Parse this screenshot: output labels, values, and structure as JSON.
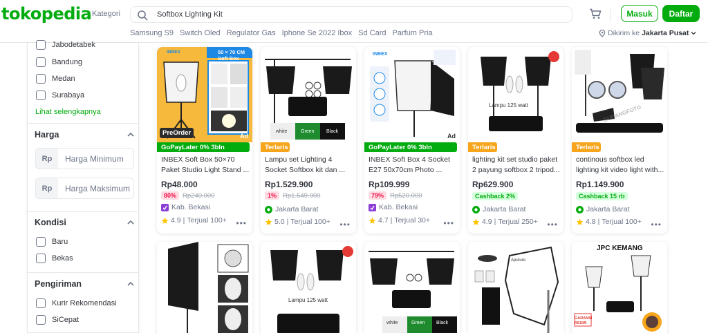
{
  "header": {
    "logo": "tokopedia",
    "kategori": "Kategori",
    "search_value": "Softbox Lighting Kit",
    "login_label": "Masuk",
    "register_label": "Daftar",
    "keywords": [
      "Samsung S9",
      "Switch Oled",
      "Regulator Gas",
      "Iphone Se 2022 Ibox",
      "Sd Card",
      "Parfum Pria"
    ],
    "location_prefix": "Dikirim ke",
    "location_value": "Jakarta Pusat"
  },
  "sidebar": {
    "locations": [
      "Jabodetabek",
      "Bandung",
      "Medan",
      "Surabaya"
    ],
    "see_more": "Lihat selengkapnya",
    "harga_title": "Harga",
    "currency": "Rp",
    "min_placeholder": "Harga Minimum",
    "max_placeholder": "Harga Maksimum",
    "kondisi_title": "Kondisi",
    "kondisi": [
      "Baru",
      "Bekas"
    ],
    "pengiriman_title": "Pengiriman",
    "pengiriman": [
      "Kurir Rekomendasi",
      "SiCepat"
    ]
  },
  "products": [
    {
      "name": "INBEX Soft Box 50×70 Paket Studio Light Stand ...",
      "ribbon": "GoPayLater 0% 3bln",
      "ribbon_type": "green",
      "price": "Rp48.000",
      "discount": "80%",
      "original_price": "Rp240.000",
      "location": "Kab. Bekasi",
      "rating": "4.9",
      "sold": "Terjual 100+",
      "img_badge": "PreOrder",
      "img_title": "50 × 70 CM Soft Box",
      "brand": "INBEX",
      "ad": "Ad"
    },
    {
      "name": "Lampu set Lighting 4 Socket Softbox kit dan ...",
      "ribbon": "Terlaris",
      "ribbon_type": "yellow",
      "price": "Rp1.529.900",
      "discount": "1%",
      "original_price": "Rp1.549.000",
      "location": "Jakarta Barat",
      "rating": "5.0",
      "sold": "Terjual 100+",
      "bg_labels": [
        "white",
        "Green",
        "Black"
      ]
    },
    {
      "name": "INBEX Soft Box 4 Socket E27 50x70cm Photo ...",
      "ribbon": "GoPayLater 0% 3bln",
      "ribbon_type": "green",
      "price": "Rp109.999",
      "discount": "79%",
      "original_price": "Rp520.000",
      "location": "Kab. Bekasi",
      "rating": "4.7",
      "sold": "Terjual 30+",
      "brand": "INBEX",
      "ad": "Ad"
    },
    {
      "name": "lighting kit set studio paket 2 payung softbox 2 tripod...",
      "ribbon": "Terlaris",
      "ribbon_type": "yellow",
      "price": "Rp629.900",
      "cashback": "Cashback 2%",
      "location": "Jakarta Barat",
      "rating": "4.9",
      "sold": "Terjual 250+",
      "img_caption": "Lampu 125 watt"
    },
    {
      "name": "continous softbox led lighting kit video light with...",
      "ribbon": "Terlaris",
      "ribbon_type": "yellow",
      "price": "Rp1.149.900",
      "cashback": "Cashback 15 rb",
      "location": "Jakarta Barat",
      "rating": "4.8",
      "sold": "Terjual 100+",
      "watermark": "GUDANGFOTO"
    }
  ],
  "row2": {
    "caption_lampu": "Lampu 125 watt",
    "bg_labels": [
      "white",
      "Green",
      "Black"
    ],
    "brand_jpc": "JPC KEMANG",
    "garansi": "GARANSI RESMI",
    "aputure": "Aputure"
  },
  "colors": {
    "brand": "#03ac0e",
    "discount": "#ef144a",
    "terlaris": "#f7a51a"
  },
  "icons": {
    "search": "search-icon",
    "cart": "cart-icon",
    "location": "location-pin-icon",
    "star": "star-icon",
    "official": "official-store-icon"
  }
}
